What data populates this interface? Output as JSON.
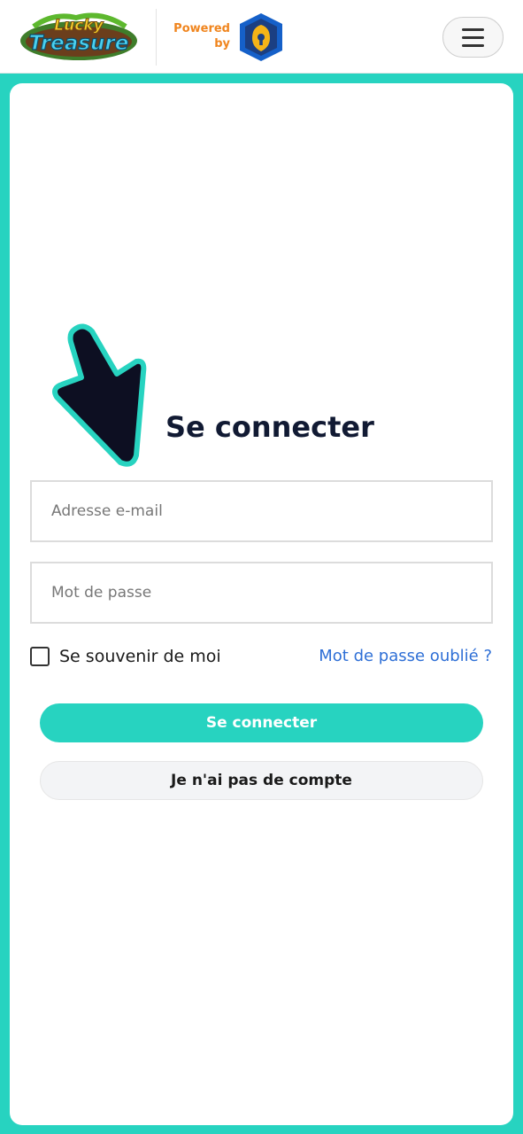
{
  "header": {
    "brand_top": "Lucky",
    "brand_bottom": "Treasure",
    "powered_line1": "Powered",
    "powered_line2": "by"
  },
  "icons": {
    "logo": "lucky-treasure-logo-icon",
    "provider": "shield-lock-icon",
    "menu": "hamburger-menu-icon",
    "pointer": "pointer-arrow-icon"
  },
  "colors": {
    "accent": "#27d3c0",
    "powered_text": "#f0851e",
    "link": "#2e6fd6",
    "title": "#111a33"
  },
  "login": {
    "title": "Se connecter",
    "email_placeholder": "Adresse e-mail",
    "password_placeholder": "Mot de passe",
    "remember_label": "Se souvenir de moi",
    "forgot_link": "Mot de passe oublié ?",
    "submit_label": "Se connecter",
    "no_account_label": "Je n'ai pas de compte"
  }
}
